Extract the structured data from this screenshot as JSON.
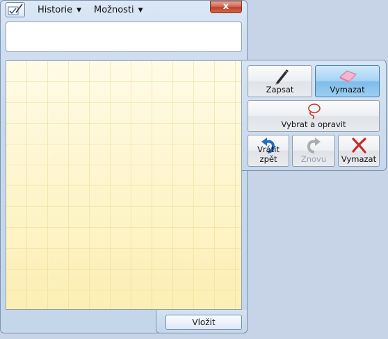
{
  "menu": {
    "history_label": "Historie",
    "options_label": "Možnosti",
    "close_label": "x"
  },
  "insert_label": "Vložit",
  "tools": {
    "write_label": "Zapsat",
    "erase_label": "Vymazat",
    "select_label": "Vybrat a opravit",
    "undo_label": "Vrátit zpět",
    "redo_label": "Znovu",
    "delete_label": "Vymazat"
  },
  "icons": {
    "app": "tablet-input-icon",
    "write": "pen-icon",
    "erase": "eraser-icon",
    "select": "lasso-icon",
    "undo": "undo-arrow-icon",
    "redo": "redo-arrow-icon",
    "delete": "red-x-icon"
  },
  "colors": {
    "pad_background": "#fdf6c9",
    "active_button": "#9ccff2",
    "close_button": "#c2402a",
    "delete_icon": "#cc2a2a",
    "undo_icon": "#1f6fc4"
  }
}
